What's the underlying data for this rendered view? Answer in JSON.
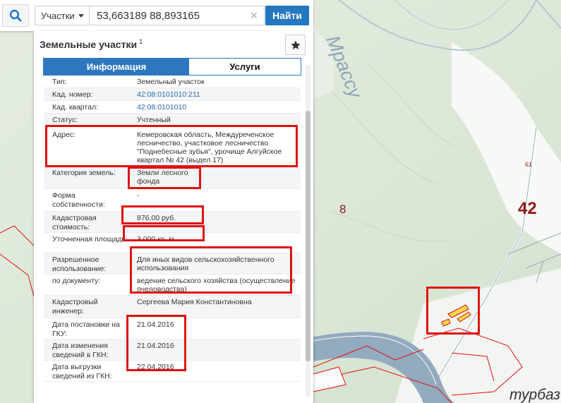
{
  "search": {
    "type_label": "Участки",
    "query": "53,663189 88,893165",
    "clear_symbol": "×",
    "find_label": "Найти"
  },
  "panel": {
    "title": "Земельные участки",
    "title_note": "1",
    "tabs": [
      {
        "label": "Информация",
        "active": true
      },
      {
        "label": "Услуги",
        "active": false
      }
    ],
    "rows": [
      {
        "label": "Тип:",
        "value": "Земельный участок"
      },
      {
        "label": "Кад. номер:",
        "value": "42:08:0101010:211"
      },
      {
        "label": "Кад. квартал:",
        "value": "42:08:0101010"
      },
      {
        "label": "Статус:",
        "value": "Учтенный"
      },
      {
        "label": "Адрес:",
        "value": "Кемеровская область, Междуреченское лесничество, участковое лесничество \"Поднебесные зубья\", урочище Алгуйское квартал № 42 (выдел 17)"
      },
      {
        "label": "Категория земель:",
        "value": "Земли лесного фонда"
      },
      {
        "label": "Форма собственности:",
        "value": "-"
      },
      {
        "label": "Кадастровая стоимость:",
        "value": "876,00 руб."
      },
      {
        "label": "Уточненная площадь:",
        "value": "3 000 кв. м"
      },
      {
        "label": "Разрешенное использование:",
        "value": "Для иных видов сельскохозяйственного использования"
      },
      {
        "label": "по документу:",
        "value": "ведение сельского хозяйства (осуществление пчеловодства)"
      },
      {
        "label": "Кадастровый инженер:",
        "value": "Сергеева Мария Константиновна"
      },
      {
        "label": "Дата постановки на ГКУ:",
        "value": "21.04.2016"
      },
      {
        "label": "Дата изменения сведений в ГКН:",
        "value": "21.04.2016"
      },
      {
        "label": "Дата выгрузки сведений из ГКН:",
        "value": "22.04.2016"
      }
    ]
  },
  "map": {
    "river_label": "Мрассу",
    "parcel_number": "8",
    "quarter_number": "42",
    "small_label_61": "61",
    "small_label_1": "1",
    "bottom_label": "турбаз",
    "colors": {
      "forest": "#dfe9d9",
      "river": "#93abbf",
      "road": "#ffffff",
      "parcel": "#e01010",
      "highlight": "#e01010",
      "accent": "#2577c2"
    }
  }
}
